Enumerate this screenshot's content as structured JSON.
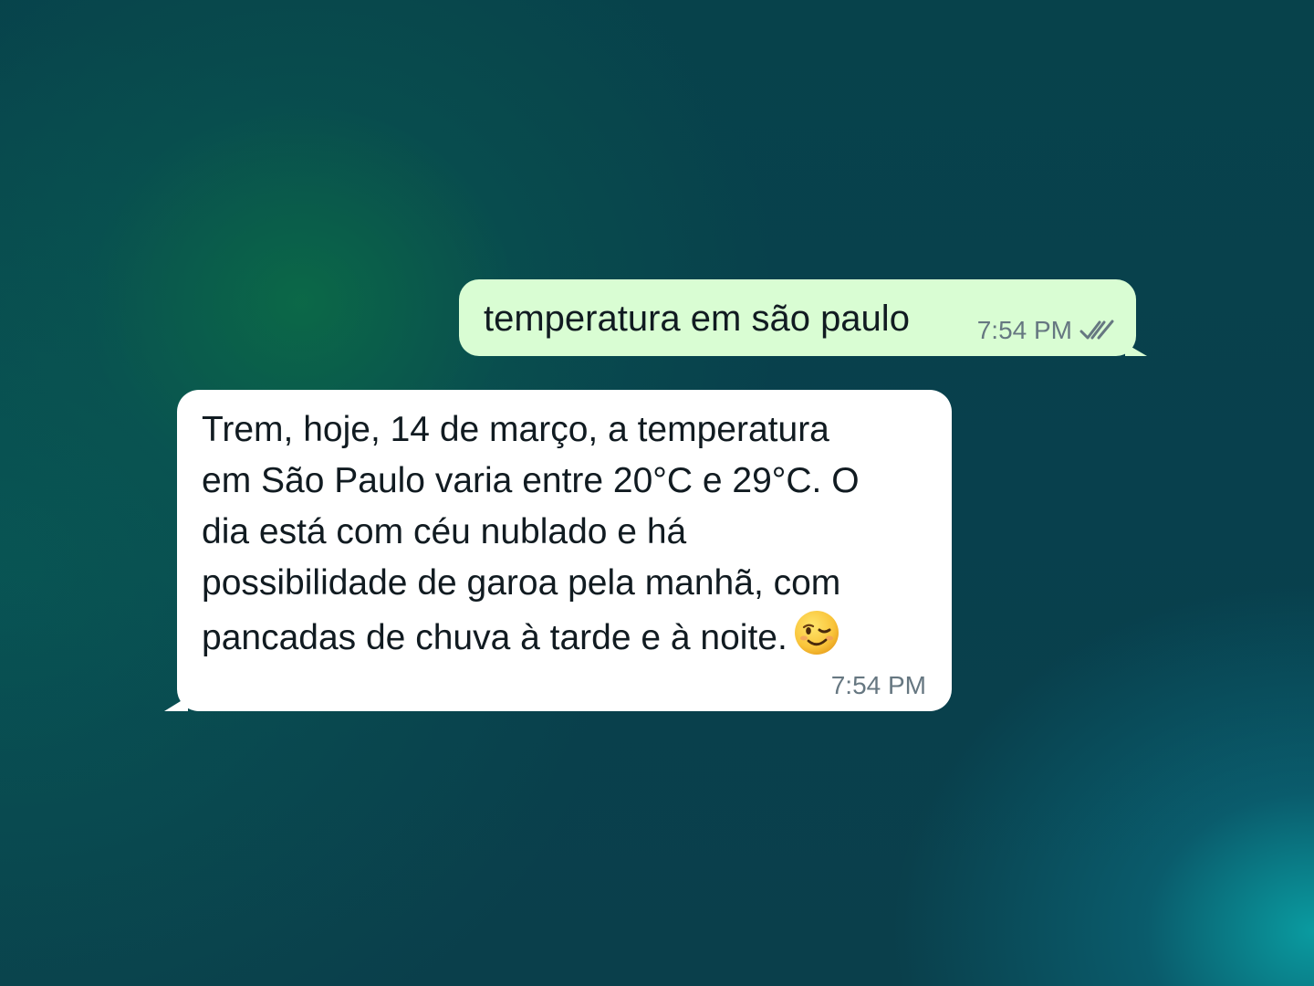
{
  "colors": {
    "outgoing_bubble": "#d9fdd3",
    "incoming_bubble": "#ffffff",
    "text": "#111b21",
    "meta_text": "#667781",
    "background_base": "#0a3f4b",
    "background_glow_green": "#0c6e46",
    "background_glow_teal": "#0aa0a5"
  },
  "messages": {
    "outgoing": {
      "text": "temperatura em são paulo",
      "time": "7:54 PM",
      "status_icon": "double-check-icon"
    },
    "incoming": {
      "lines": [
        "Trem, hoje, 14 de março, a temperatura",
        "em São Paulo varia entre 20°C e 29°C. O",
        "dia está com céu nublado e há",
        "possibilidade de garoa pela manhã, com",
        "pancadas de chuva à tarde e à noite."
      ],
      "emoji": "winking-face-emoji",
      "time": "7:54 PM"
    }
  }
}
